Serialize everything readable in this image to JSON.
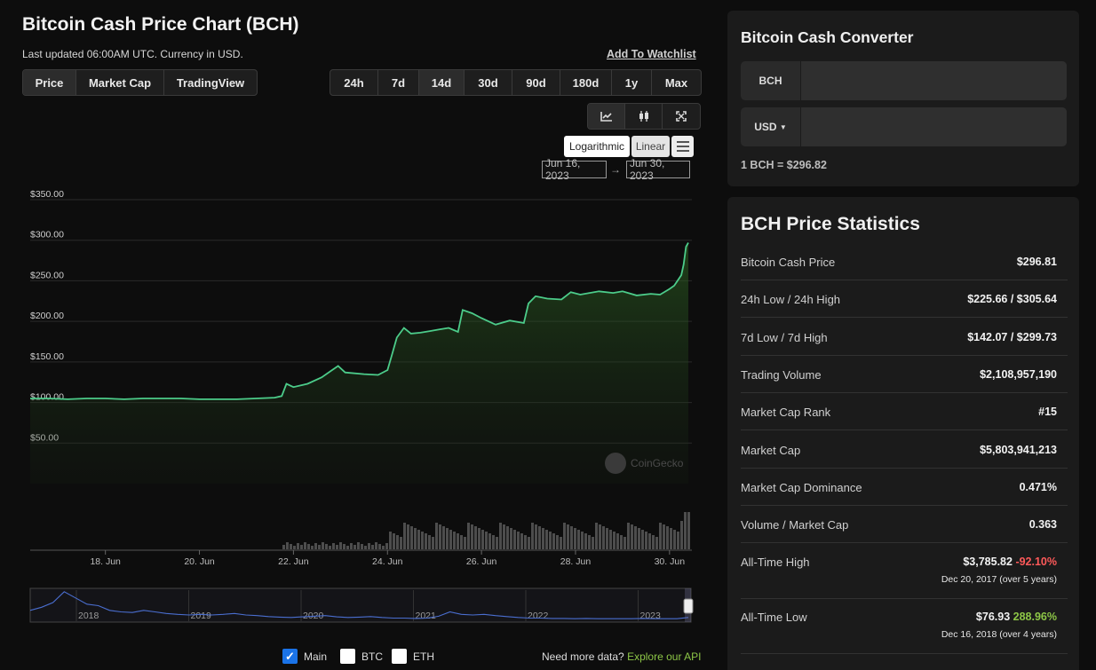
{
  "header": {
    "title": "Bitcoin Cash Price Chart (BCH)",
    "updated": "Last updated 06:00AM UTC. Currency in USD.",
    "watchlist": "Add To Watchlist"
  },
  "view_tabs": [
    {
      "label": "Price",
      "active": true
    },
    {
      "label": "Market Cap",
      "active": false
    },
    {
      "label": "TradingView",
      "active": false
    }
  ],
  "range_tabs": [
    {
      "label": "24h"
    },
    {
      "label": "7d"
    },
    {
      "label": "14d",
      "active": true
    },
    {
      "label": "30d"
    },
    {
      "label": "90d"
    },
    {
      "label": "180d"
    },
    {
      "label": "1y"
    },
    {
      "label": "Max"
    }
  ],
  "scale": {
    "log": "Logarithmic",
    "linear": "Linear"
  },
  "date_range": {
    "from": "Jun 16, 2023",
    "arrow": "→",
    "to": "Jun 30, 2023"
  },
  "chart_data": {
    "type": "area",
    "y_ticks": [
      "$350.00",
      "$300.00",
      "$250.00",
      "$200.00",
      "$150.00",
      "$100.00",
      "$50.00"
    ],
    "ylim": [
      0,
      350
    ],
    "x_ticks": [
      "18. Jun",
      "20. Jun",
      "22. Jun",
      "24. Jun",
      "26. Jun",
      "28. Jun",
      "30. Jun"
    ],
    "x_range_days": [
      16.4,
      30.4
    ],
    "grid": true,
    "watermark": "CoinGecko",
    "line_color": "#4ccc8a",
    "price": [
      [
        16.4,
        105
      ],
      [
        16.8,
        105
      ],
      [
        17.2,
        104
      ],
      [
        17.6,
        105
      ],
      [
        18.0,
        105
      ],
      [
        18.4,
        104
      ],
      [
        18.8,
        105
      ],
      [
        19.2,
        105
      ],
      [
        19.6,
        105
      ],
      [
        20.0,
        104
      ],
      [
        20.4,
        104
      ],
      [
        20.8,
        104
      ],
      [
        21.2,
        105
      ],
      [
        21.6,
        106
      ],
      [
        21.75,
        108
      ],
      [
        21.85,
        123
      ],
      [
        22.0,
        119
      ],
      [
        22.3,
        123
      ],
      [
        22.6,
        131
      ],
      [
        22.8,
        139
      ],
      [
        22.95,
        145
      ],
      [
        23.1,
        137
      ],
      [
        23.5,
        135
      ],
      [
        23.8,
        134
      ],
      [
        24.0,
        140
      ],
      [
        24.1,
        160
      ],
      [
        24.2,
        180
      ],
      [
        24.35,
        192
      ],
      [
        24.5,
        185
      ],
      [
        24.7,
        186
      ],
      [
        24.9,
        188
      ],
      [
        25.1,
        190
      ],
      [
        25.3,
        192
      ],
      [
        25.5,
        187
      ],
      [
        25.6,
        214
      ],
      [
        25.8,
        210
      ],
      [
        26.0,
        204
      ],
      [
        26.3,
        196
      ],
      [
        26.6,
        201
      ],
      [
        26.9,
        198
      ],
      [
        27.0,
        222
      ],
      [
        27.15,
        231
      ],
      [
        27.4,
        228
      ],
      [
        27.7,
        227
      ],
      [
        27.9,
        236
      ],
      [
        28.1,
        233
      ],
      [
        28.5,
        237
      ],
      [
        28.8,
        235
      ],
      [
        29.0,
        237
      ],
      [
        29.3,
        232
      ],
      [
        29.6,
        234
      ],
      [
        29.8,
        233
      ],
      [
        30.0,
        240
      ],
      [
        30.1,
        244
      ],
      [
        30.25,
        257
      ],
      [
        30.3,
        270
      ],
      [
        30.35,
        292
      ],
      [
        30.4,
        297
      ]
    ],
    "navigator": {
      "x_ticks": [
        "2018",
        "2019",
        "2020",
        "2021",
        "2022",
        "2023"
      ],
      "values": [
        0.35,
        0.45,
        0.6,
        0.95,
        0.75,
        0.55,
        0.5,
        0.35,
        0.3,
        0.28,
        0.35,
        0.3,
        0.25,
        0.22,
        0.2,
        0.22,
        0.2,
        0.22,
        0.25,
        0.2,
        0.18,
        0.15,
        0.13,
        0.12,
        0.14,
        0.16,
        0.18,
        0.14,
        0.12,
        0.13,
        0.15,
        0.12,
        0.1,
        0.1,
        0.09,
        0.1,
        0.16,
        0.3,
        0.22,
        0.2,
        0.22,
        0.18,
        0.15,
        0.12,
        0.1,
        0.1,
        0.09,
        0.09,
        0.08,
        0.09,
        0.08,
        0.08,
        0.08,
        0.08,
        0.09,
        0.08,
        0.08,
        0.08,
        0.12
      ]
    }
  },
  "series_toggles": [
    {
      "label": "Main",
      "checked": true
    },
    {
      "label": "BTC",
      "checked": false
    },
    {
      "label": "ETH",
      "checked": false
    }
  ],
  "api": {
    "text": "Need more data?",
    "link": "Explore our API"
  },
  "converter": {
    "title": "Bitcoin Cash Converter",
    "from": "BCH",
    "to": "USD",
    "rate": "1 BCH = $296.82"
  },
  "stats": {
    "title": "BCH Price Statistics",
    "rows": [
      {
        "label": "Bitcoin Cash Price",
        "value": "$296.81"
      },
      {
        "label": "24h Low / 24h High",
        "value": "$225.66 / $305.64"
      },
      {
        "label": "7d Low / 7d High",
        "value": "$142.07 / $299.73"
      },
      {
        "label": "Trading Volume",
        "value": "$2,108,957,190"
      },
      {
        "label": "Market Cap Rank",
        "value": "#15"
      },
      {
        "label": "Market Cap",
        "value": "$5,803,941,213"
      },
      {
        "label": "Market Cap Dominance",
        "value": "0.471%"
      },
      {
        "label": "Volume / Market Cap",
        "value": "0.363"
      }
    ],
    "ath": {
      "label": "All-Time High",
      "value": "$3,785.82",
      "change": "-92.10%",
      "date": "Dec 20, 2017 (over 5 years)"
    },
    "atl": {
      "label": "All-Time Low",
      "value": "$76.93",
      "change": "288.96%",
      "date": "Dec 16, 2018 (over 4 years)"
    }
  }
}
